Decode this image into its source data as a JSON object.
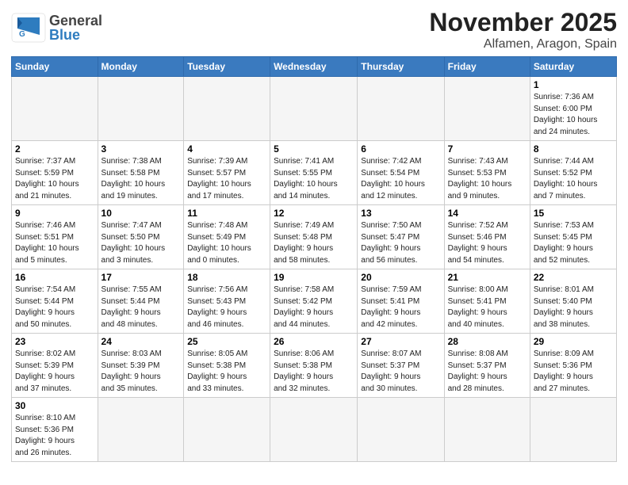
{
  "header": {
    "logo_general": "General",
    "logo_blue": "Blue",
    "month_year": "November 2025",
    "location": "Alfamen, Aragon, Spain"
  },
  "weekdays": [
    "Sunday",
    "Monday",
    "Tuesday",
    "Wednesday",
    "Thursday",
    "Friday",
    "Saturday"
  ],
  "weeks": [
    [
      {
        "num": "",
        "info": ""
      },
      {
        "num": "",
        "info": ""
      },
      {
        "num": "",
        "info": ""
      },
      {
        "num": "",
        "info": ""
      },
      {
        "num": "",
        "info": ""
      },
      {
        "num": "",
        "info": ""
      },
      {
        "num": "1",
        "info": "Sunrise: 7:36 AM\nSunset: 6:00 PM\nDaylight: 10 hours\nand 24 minutes."
      }
    ],
    [
      {
        "num": "2",
        "info": "Sunrise: 7:37 AM\nSunset: 5:59 PM\nDaylight: 10 hours\nand 21 minutes."
      },
      {
        "num": "3",
        "info": "Sunrise: 7:38 AM\nSunset: 5:58 PM\nDaylight: 10 hours\nand 19 minutes."
      },
      {
        "num": "4",
        "info": "Sunrise: 7:39 AM\nSunset: 5:57 PM\nDaylight: 10 hours\nand 17 minutes."
      },
      {
        "num": "5",
        "info": "Sunrise: 7:41 AM\nSunset: 5:55 PM\nDaylight: 10 hours\nand 14 minutes."
      },
      {
        "num": "6",
        "info": "Sunrise: 7:42 AM\nSunset: 5:54 PM\nDaylight: 10 hours\nand 12 minutes."
      },
      {
        "num": "7",
        "info": "Sunrise: 7:43 AM\nSunset: 5:53 PM\nDaylight: 10 hours\nand 9 minutes."
      },
      {
        "num": "8",
        "info": "Sunrise: 7:44 AM\nSunset: 5:52 PM\nDaylight: 10 hours\nand 7 minutes."
      }
    ],
    [
      {
        "num": "9",
        "info": "Sunrise: 7:46 AM\nSunset: 5:51 PM\nDaylight: 10 hours\nand 5 minutes."
      },
      {
        "num": "10",
        "info": "Sunrise: 7:47 AM\nSunset: 5:50 PM\nDaylight: 10 hours\nand 3 minutes."
      },
      {
        "num": "11",
        "info": "Sunrise: 7:48 AM\nSunset: 5:49 PM\nDaylight: 10 hours\nand 0 minutes."
      },
      {
        "num": "12",
        "info": "Sunrise: 7:49 AM\nSunset: 5:48 PM\nDaylight: 9 hours\nand 58 minutes."
      },
      {
        "num": "13",
        "info": "Sunrise: 7:50 AM\nSunset: 5:47 PM\nDaylight: 9 hours\nand 56 minutes."
      },
      {
        "num": "14",
        "info": "Sunrise: 7:52 AM\nSunset: 5:46 PM\nDaylight: 9 hours\nand 54 minutes."
      },
      {
        "num": "15",
        "info": "Sunrise: 7:53 AM\nSunset: 5:45 PM\nDaylight: 9 hours\nand 52 minutes."
      }
    ],
    [
      {
        "num": "16",
        "info": "Sunrise: 7:54 AM\nSunset: 5:44 PM\nDaylight: 9 hours\nand 50 minutes."
      },
      {
        "num": "17",
        "info": "Sunrise: 7:55 AM\nSunset: 5:44 PM\nDaylight: 9 hours\nand 48 minutes."
      },
      {
        "num": "18",
        "info": "Sunrise: 7:56 AM\nSunset: 5:43 PM\nDaylight: 9 hours\nand 46 minutes."
      },
      {
        "num": "19",
        "info": "Sunrise: 7:58 AM\nSunset: 5:42 PM\nDaylight: 9 hours\nand 44 minutes."
      },
      {
        "num": "20",
        "info": "Sunrise: 7:59 AM\nSunset: 5:41 PM\nDaylight: 9 hours\nand 42 minutes."
      },
      {
        "num": "21",
        "info": "Sunrise: 8:00 AM\nSunset: 5:41 PM\nDaylight: 9 hours\nand 40 minutes."
      },
      {
        "num": "22",
        "info": "Sunrise: 8:01 AM\nSunset: 5:40 PM\nDaylight: 9 hours\nand 38 minutes."
      }
    ],
    [
      {
        "num": "23",
        "info": "Sunrise: 8:02 AM\nSunset: 5:39 PM\nDaylight: 9 hours\nand 37 minutes."
      },
      {
        "num": "24",
        "info": "Sunrise: 8:03 AM\nSunset: 5:39 PM\nDaylight: 9 hours\nand 35 minutes."
      },
      {
        "num": "25",
        "info": "Sunrise: 8:05 AM\nSunset: 5:38 PM\nDaylight: 9 hours\nand 33 minutes."
      },
      {
        "num": "26",
        "info": "Sunrise: 8:06 AM\nSunset: 5:38 PM\nDaylight: 9 hours\nand 32 minutes."
      },
      {
        "num": "27",
        "info": "Sunrise: 8:07 AM\nSunset: 5:37 PM\nDaylight: 9 hours\nand 30 minutes."
      },
      {
        "num": "28",
        "info": "Sunrise: 8:08 AM\nSunset: 5:37 PM\nDaylight: 9 hours\nand 28 minutes."
      },
      {
        "num": "29",
        "info": "Sunrise: 8:09 AM\nSunset: 5:36 PM\nDaylight: 9 hours\nand 27 minutes."
      }
    ],
    [
      {
        "num": "30",
        "info": "Sunrise: 8:10 AM\nSunset: 5:36 PM\nDaylight: 9 hours\nand 26 minutes."
      },
      {
        "num": "",
        "info": ""
      },
      {
        "num": "",
        "info": ""
      },
      {
        "num": "",
        "info": ""
      },
      {
        "num": "",
        "info": ""
      },
      {
        "num": "",
        "info": ""
      },
      {
        "num": "",
        "info": ""
      }
    ]
  ]
}
